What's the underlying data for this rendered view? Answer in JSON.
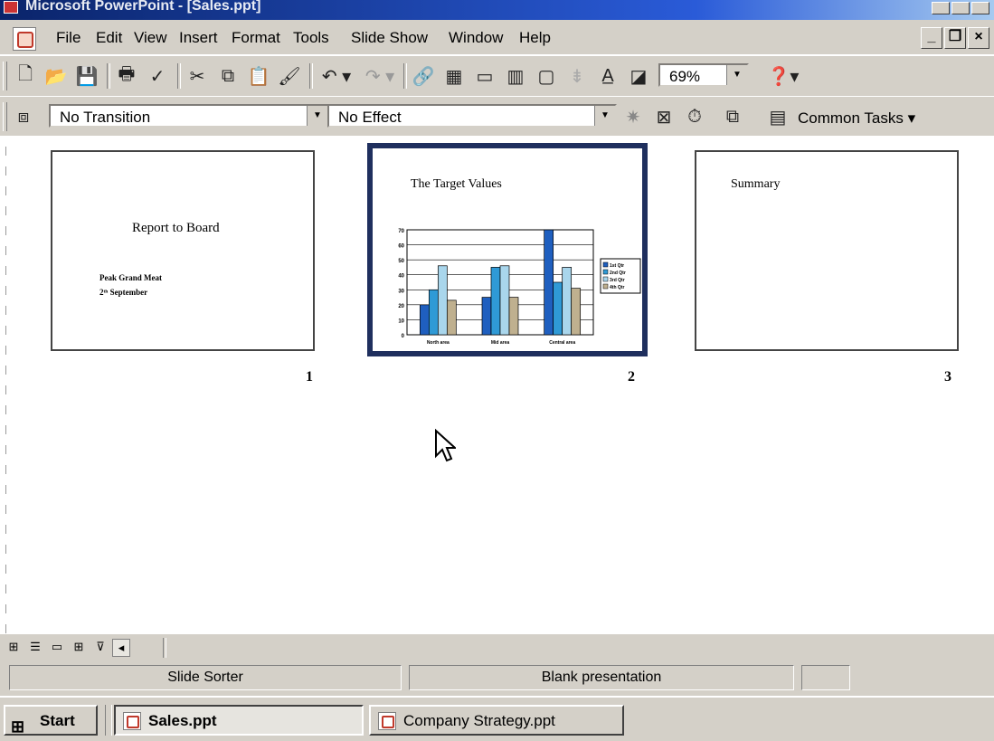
{
  "window": {
    "title": "Microsoft PowerPoint - [Sales.ppt]"
  },
  "menu": [
    "File",
    "Edit",
    "View",
    "Insert",
    "Format",
    "Tools",
    "Slide Show",
    "Window",
    "Help"
  ],
  "toolbar": {
    "zoom": "69%",
    "transition": "No Transition",
    "effect": "No Effect",
    "common_tasks": "Common Tasks"
  },
  "slides": [
    {
      "number": "1",
      "title": "Report to Board",
      "sub1": "Peak Grand Meat",
      "sub2": "2ᵗʰ September"
    },
    {
      "number": "2",
      "title": "The Target Values"
    },
    {
      "number": "3",
      "title": "Summary"
    }
  ],
  "chart_data": {
    "type": "bar",
    "categories": [
      "North area",
      "Mid area",
      "Central area"
    ],
    "series": [
      {
        "name": "1st Qtr",
        "values": [
          20,
          25,
          70
        ],
        "color": "#1f5fbf"
      },
      {
        "name": "2nd Qtr",
        "values": [
          30,
          45,
          35
        ],
        "color": "#2f9ad6"
      },
      {
        "name": "3rd Qtr",
        "values": [
          46,
          46,
          45
        ],
        "color": "#a9d6ec"
      },
      {
        "name": "4th Qtr",
        "values": [
          23,
          25,
          31
        ],
        "color": "#bfb08f"
      }
    ],
    "ylim": [
      0,
      70
    ],
    "yticks": [
      "0",
      "10",
      "20",
      "30",
      "40",
      "50",
      "60",
      "70"
    ]
  },
  "status": {
    "view": "Slide Sorter",
    "design": "Blank presentation"
  },
  "taskbar": {
    "start": "Start",
    "tasks": [
      "Sales.ppt",
      "Company Strategy.ppt"
    ]
  },
  "colors": {
    "accent": "#0a246a",
    "slide_border_selected": "#1f2f5e"
  }
}
